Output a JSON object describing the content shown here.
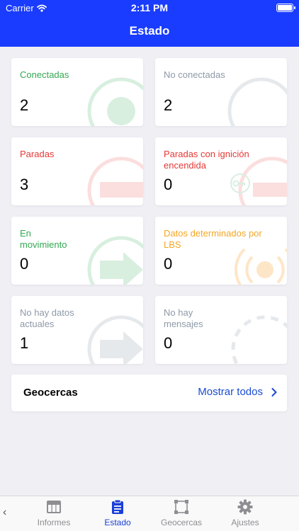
{
  "status_bar": {
    "carrier": "Carrier",
    "time": "2:11 PM"
  },
  "header": {
    "title": "Estado"
  },
  "colors": {
    "accent": "#1a3cff",
    "green": "#34a853",
    "red": "#e53935",
    "orange": "#f5a623",
    "gray": "#8e9aa8"
  },
  "cards": [
    {
      "label": "Conectadas",
      "count": "2",
      "color": "green",
      "icon": "connected-circle-icon"
    },
    {
      "label": "No conectadas",
      "count": "2",
      "color": "gray",
      "icon": "disconnected-circle-icon"
    },
    {
      "label": "Paradas",
      "count": "3",
      "color": "red",
      "icon": "stopped-icon"
    },
    {
      "label": "Paradas con ignición encendida",
      "count": "0",
      "color": "red",
      "icon": "ignition-key-icon"
    },
    {
      "label": "En movimiento",
      "count": "0",
      "color": "green",
      "icon": "moving-arrow-icon"
    },
    {
      "label": "Datos determinados por LBS",
      "count": "0",
      "color": "orange",
      "icon": "lbs-signal-icon"
    },
    {
      "label": "No hay datos actuales",
      "count": "1",
      "color": "gray",
      "icon": "no-data-arrow-icon"
    },
    {
      "label": "No hay mensajes",
      "count": "0",
      "color": "gray",
      "icon": "no-messages-dashed-circle-icon"
    }
  ],
  "geofences": {
    "title": "Geocercas",
    "link": "Mostrar todos"
  },
  "tabs": [
    {
      "label": "Informes",
      "icon": "reports-table-icon"
    },
    {
      "label": "Estado",
      "icon": "clipboard-icon"
    },
    {
      "label": "Geocercas",
      "icon": "geofence-square-icon"
    },
    {
      "label": "Ajustes",
      "icon": "gear-icon"
    }
  ]
}
